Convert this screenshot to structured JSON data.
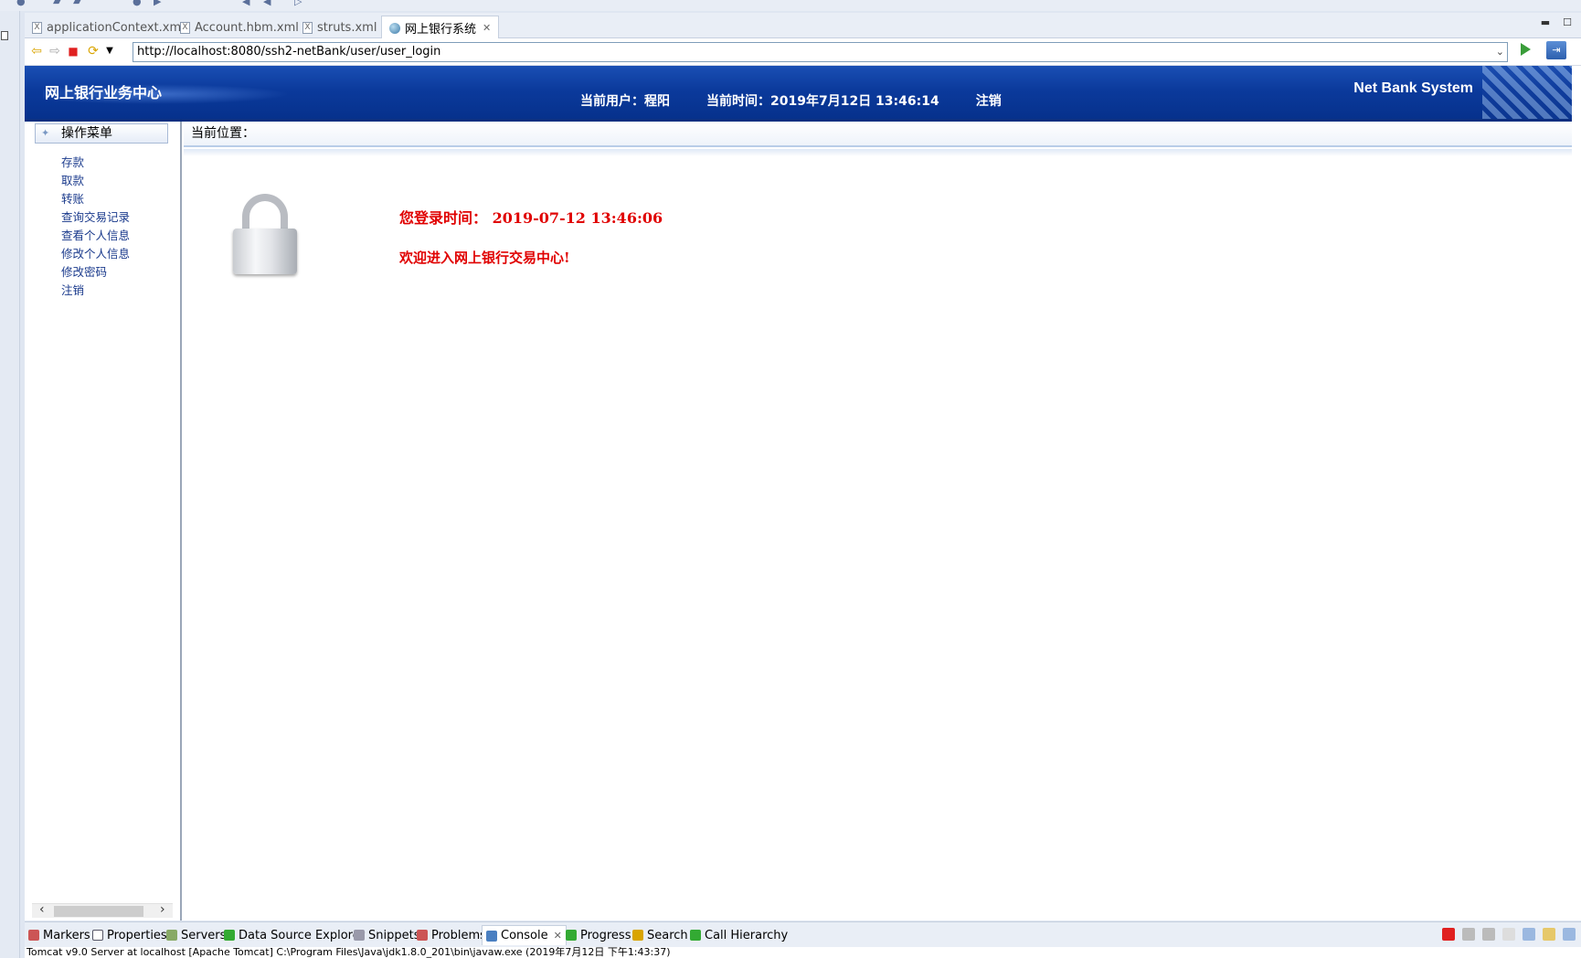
{
  "editor_tabs": [
    {
      "label": "applicationContext.xml",
      "icon": "xml-file-icon"
    },
    {
      "label": "Account.hbm.xml",
      "icon": "xml-file-icon"
    },
    {
      "label": "struts.xml",
      "icon": "xml-file-icon"
    },
    {
      "label": "网上银行系统",
      "icon": "globe-icon",
      "active": true
    }
  ],
  "browser": {
    "url": "http://localhost:8080/ssh2-netBank/user/user_login"
  },
  "banner": {
    "title": "网上银行业务中心",
    "current_user": "当前用户：程阳",
    "current_time": "当前时间：2019年7月12日 13:46:14",
    "logout": "注销",
    "brand": "Net Bank System"
  },
  "sidebar": {
    "header": "操作菜单",
    "items": [
      "存款",
      "取款",
      "转账",
      "查询交易记录",
      "查看个人信息",
      "修改个人信息",
      "修改密码",
      "注销"
    ]
  },
  "breadcrumb": "当前位置：",
  "content": {
    "login_time_label": "您登录时间：",
    "login_time_value": "2019-07-12 13:46:06",
    "welcome": "欢迎进入网上银行交易中心!"
  },
  "views": [
    {
      "label": "Markers",
      "icon": "markers-icon"
    },
    {
      "label": "Properties",
      "icon": "properties-icon"
    },
    {
      "label": "Servers",
      "icon": "servers-icon"
    },
    {
      "label": "Data Source Explorer",
      "icon": "data-source-icon"
    },
    {
      "label": "Snippets",
      "icon": "snippets-icon"
    },
    {
      "label": "Problems",
      "icon": "problems-icon"
    },
    {
      "label": "Console",
      "icon": "console-icon",
      "active": true
    },
    {
      "label": "Progress",
      "icon": "progress-icon"
    },
    {
      "label": "Search",
      "icon": "search-icon"
    },
    {
      "label": "Call Hierarchy",
      "icon": "call-hierarchy-icon"
    }
  ],
  "console_text": "Tomcat v9.0 Server at localhost [Apache Tomcat] C:\\Program Files\\Java\\jdk1.8.0_201\\bin\\javaw.exe (2019年7月12日 下午1:43:37)",
  "colors": {
    "banner": "#0b3a9c",
    "accent_red": "#e00000",
    "menu_link": "#1a3a8c"
  }
}
